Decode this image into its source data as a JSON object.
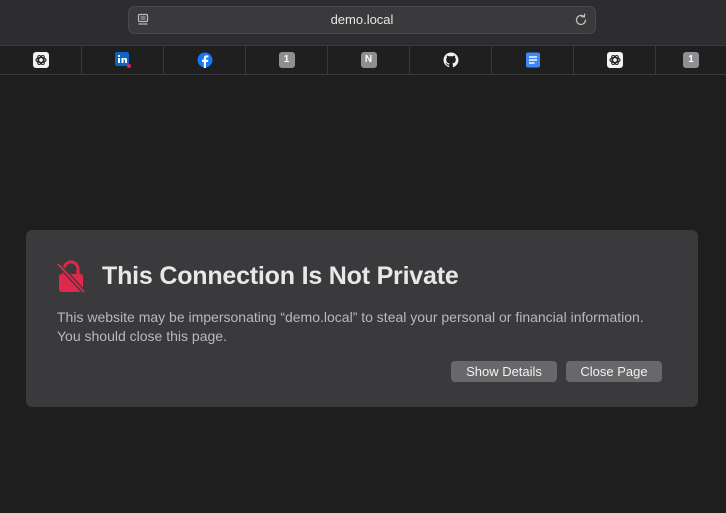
{
  "address_bar": {
    "url": "demo.local",
    "reader_icon": "reader-mode-icon",
    "reload_icon": "reload-icon"
  },
  "favorites": [
    {
      "name": "chatgpt",
      "icon": "openai-icon",
      "badge": ""
    },
    {
      "name": "linkedin",
      "icon": "linkedin-icon",
      "badge": ""
    },
    {
      "name": "facebook",
      "icon": "facebook-icon",
      "badge": ""
    },
    {
      "name": "badge-1",
      "icon": "badge-icon",
      "badge": "1"
    },
    {
      "name": "notion",
      "icon": "notion-icon",
      "badge": "N"
    },
    {
      "name": "github",
      "icon": "github-icon",
      "badge": ""
    },
    {
      "name": "google-docs",
      "icon": "docs-icon",
      "badge": ""
    },
    {
      "name": "chatgpt-2",
      "icon": "openai-icon",
      "badge": ""
    },
    {
      "name": "badge-1-2",
      "icon": "badge-icon",
      "badge": "1"
    }
  ],
  "warning": {
    "title": "This Connection Is Not Private",
    "message": "This website may be impersonating “demo.local” to steal your personal or financial information. You should close this page.",
    "show_details_label": "Show Details",
    "close_page_label": "Close Page",
    "icon": "broken-lock-icon"
  },
  "colors": {
    "warning_icon": "#e0284a",
    "card_background": "#3a3a3c",
    "page_background": "#1e1e1e",
    "button_background": "#68686b"
  }
}
